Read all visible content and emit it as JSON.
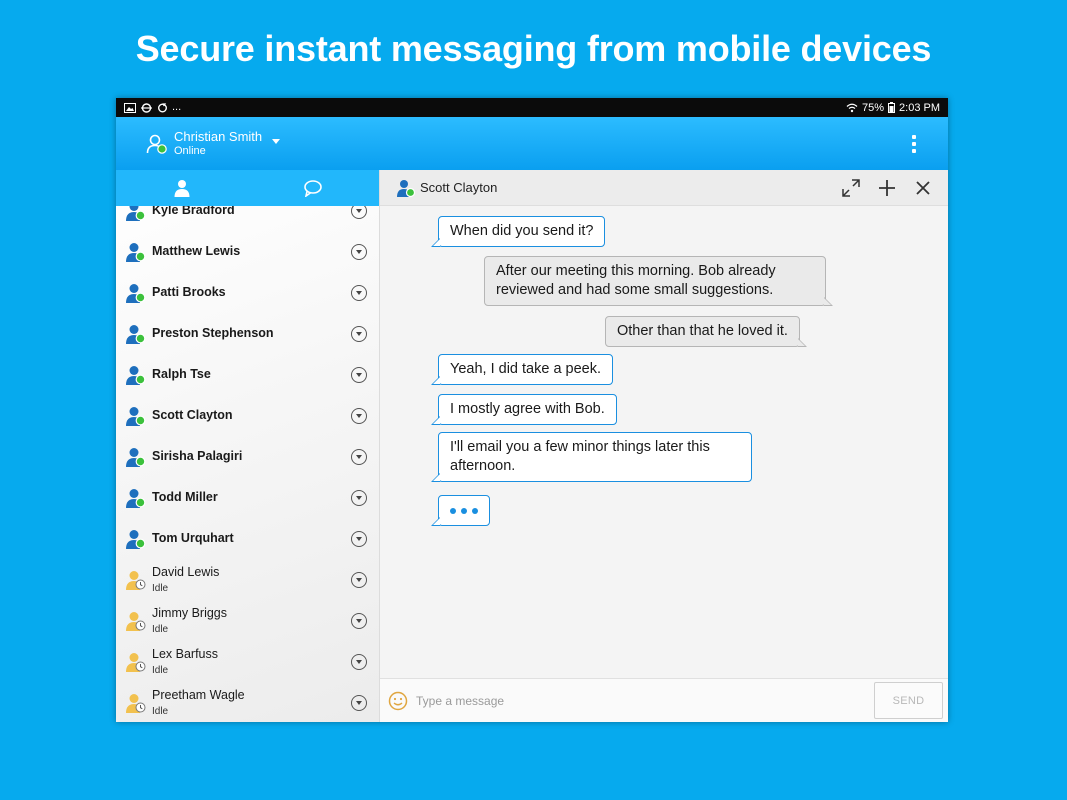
{
  "headline": "Secure instant messaging from mobile devices",
  "statusbar": {
    "left_icons": [
      "image-icon",
      "cloud-sync-icon",
      "sync-icon"
    ],
    "more": "...",
    "battery": "75%",
    "time": "2:03 PM"
  },
  "me": {
    "name": "Christian Smith",
    "status": "Online"
  },
  "contacts": [
    {
      "name": "Kyle Bradford",
      "state": "online"
    },
    {
      "name": "Matthew Lewis",
      "state": "online"
    },
    {
      "name": "Patti Brooks",
      "state": "online"
    },
    {
      "name": "Preston Stephenson",
      "state": "online"
    },
    {
      "name": "Ralph Tse",
      "state": "online"
    },
    {
      "name": "Scott Clayton",
      "state": "online"
    },
    {
      "name": "Sirisha Palagiri",
      "state": "online"
    },
    {
      "name": "Todd Miller",
      "state": "online"
    },
    {
      "name": "Tom Urquhart",
      "state": "online"
    },
    {
      "name": "David Lewis",
      "state": "idle",
      "sub": "Idle"
    },
    {
      "name": "Jimmy Briggs",
      "state": "idle",
      "sub": "Idle"
    },
    {
      "name": "Lex Barfuss",
      "state": "idle",
      "sub": "Idle"
    },
    {
      "name": "Preetham Wagle",
      "state": "idle",
      "sub": "Idle"
    }
  ],
  "chat": {
    "peer": "Scott Clayton",
    "messages": [
      {
        "dir": "in",
        "text": "When did you send it?"
      },
      {
        "dir": "out",
        "text": "After our meeting this morning. Bob already reviewed and had some small suggestions."
      },
      {
        "dir": "out",
        "text": "Other than that he loved it."
      },
      {
        "dir": "in",
        "text": "Yeah, I did take a peek."
      },
      {
        "dir": "in",
        "text": "I mostly agree with Bob."
      },
      {
        "dir": "in",
        "text": "I'll email you a few minor things later this afternoon."
      },
      {
        "dir": "in",
        "typing": true
      }
    ]
  },
  "composer": {
    "placeholder": "Type a message",
    "send_label": "SEND"
  },
  "colors": {
    "background": "#06aaee",
    "appbar": "#12aaf5",
    "accent": "#1a8fe0",
    "presence_online": "#3cc13c",
    "idle": "#f2c14e"
  }
}
